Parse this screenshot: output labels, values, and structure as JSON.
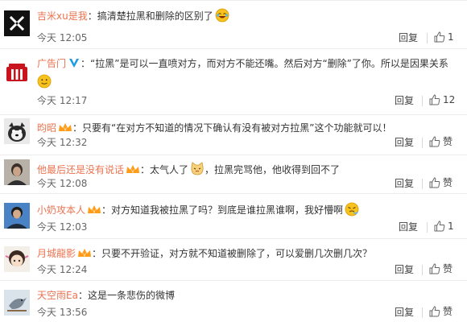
{
  "comments": [
    {
      "user": "吉米xu是我",
      "colon": "：",
      "text": "搞清楚拉黑和删除的区别了",
      "time": "今天 12:05",
      "reply": "回复",
      "likes": "1"
    },
    {
      "user": "广告门",
      "colon": "：",
      "text": "“拉黑”是可以一直喷对方，而对方不能还嘴。然后对方“删除”了你。所以是因果关系",
      "time": "今天 12:17",
      "reply": "回复",
      "likes": "12"
    },
    {
      "user": "昀昭",
      "colon": "：",
      "text": "只要有“在对方不知道的情况下确认有没有被对方拉黑”这个功能就可以！",
      "time": "今天 12:32",
      "reply": "回复",
      "likes": "赞"
    },
    {
      "user": "他最后还是没有说话",
      "colon": "：",
      "text": "太气人了",
      "text2": "，拉黑完骂他，他收得到回不了",
      "time": "今天 12:08",
      "reply": "回复",
      "likes": "赞"
    },
    {
      "user": "小奶攻本人",
      "colon": "：",
      "text": "对方知道我被拉黑了吗？到底是谁拉黑谁啊，我好懵啊",
      "time": "今天 12:03",
      "reply": "回复",
      "likes": "1"
    },
    {
      "user": "月城龍影",
      "colon": "：",
      "text": "只要不开验证，对方就不知道被删除了，可以爱删几次删几次？",
      "time": "今天 12:24",
      "reply": "回复",
      "likes": "赞"
    },
    {
      "user": "天空雨Ea",
      "colon": "：",
      "text": "这是一条悲伤的微博",
      "time": "今天 13:56",
      "reply": "回复",
      "likes": "赞"
    }
  ],
  "colors": {
    "username": "#eb7350",
    "text": "#333333",
    "meta": "#666666",
    "divider": "#ececec"
  },
  "icons": [
    "x-logo-avatar",
    "megaphone-avatar",
    "vip-crown-badge",
    "verified-v-badge",
    "laugh-emoji",
    "smile-emoji",
    "cat-emoji",
    "thumbs-up-icon"
  ]
}
